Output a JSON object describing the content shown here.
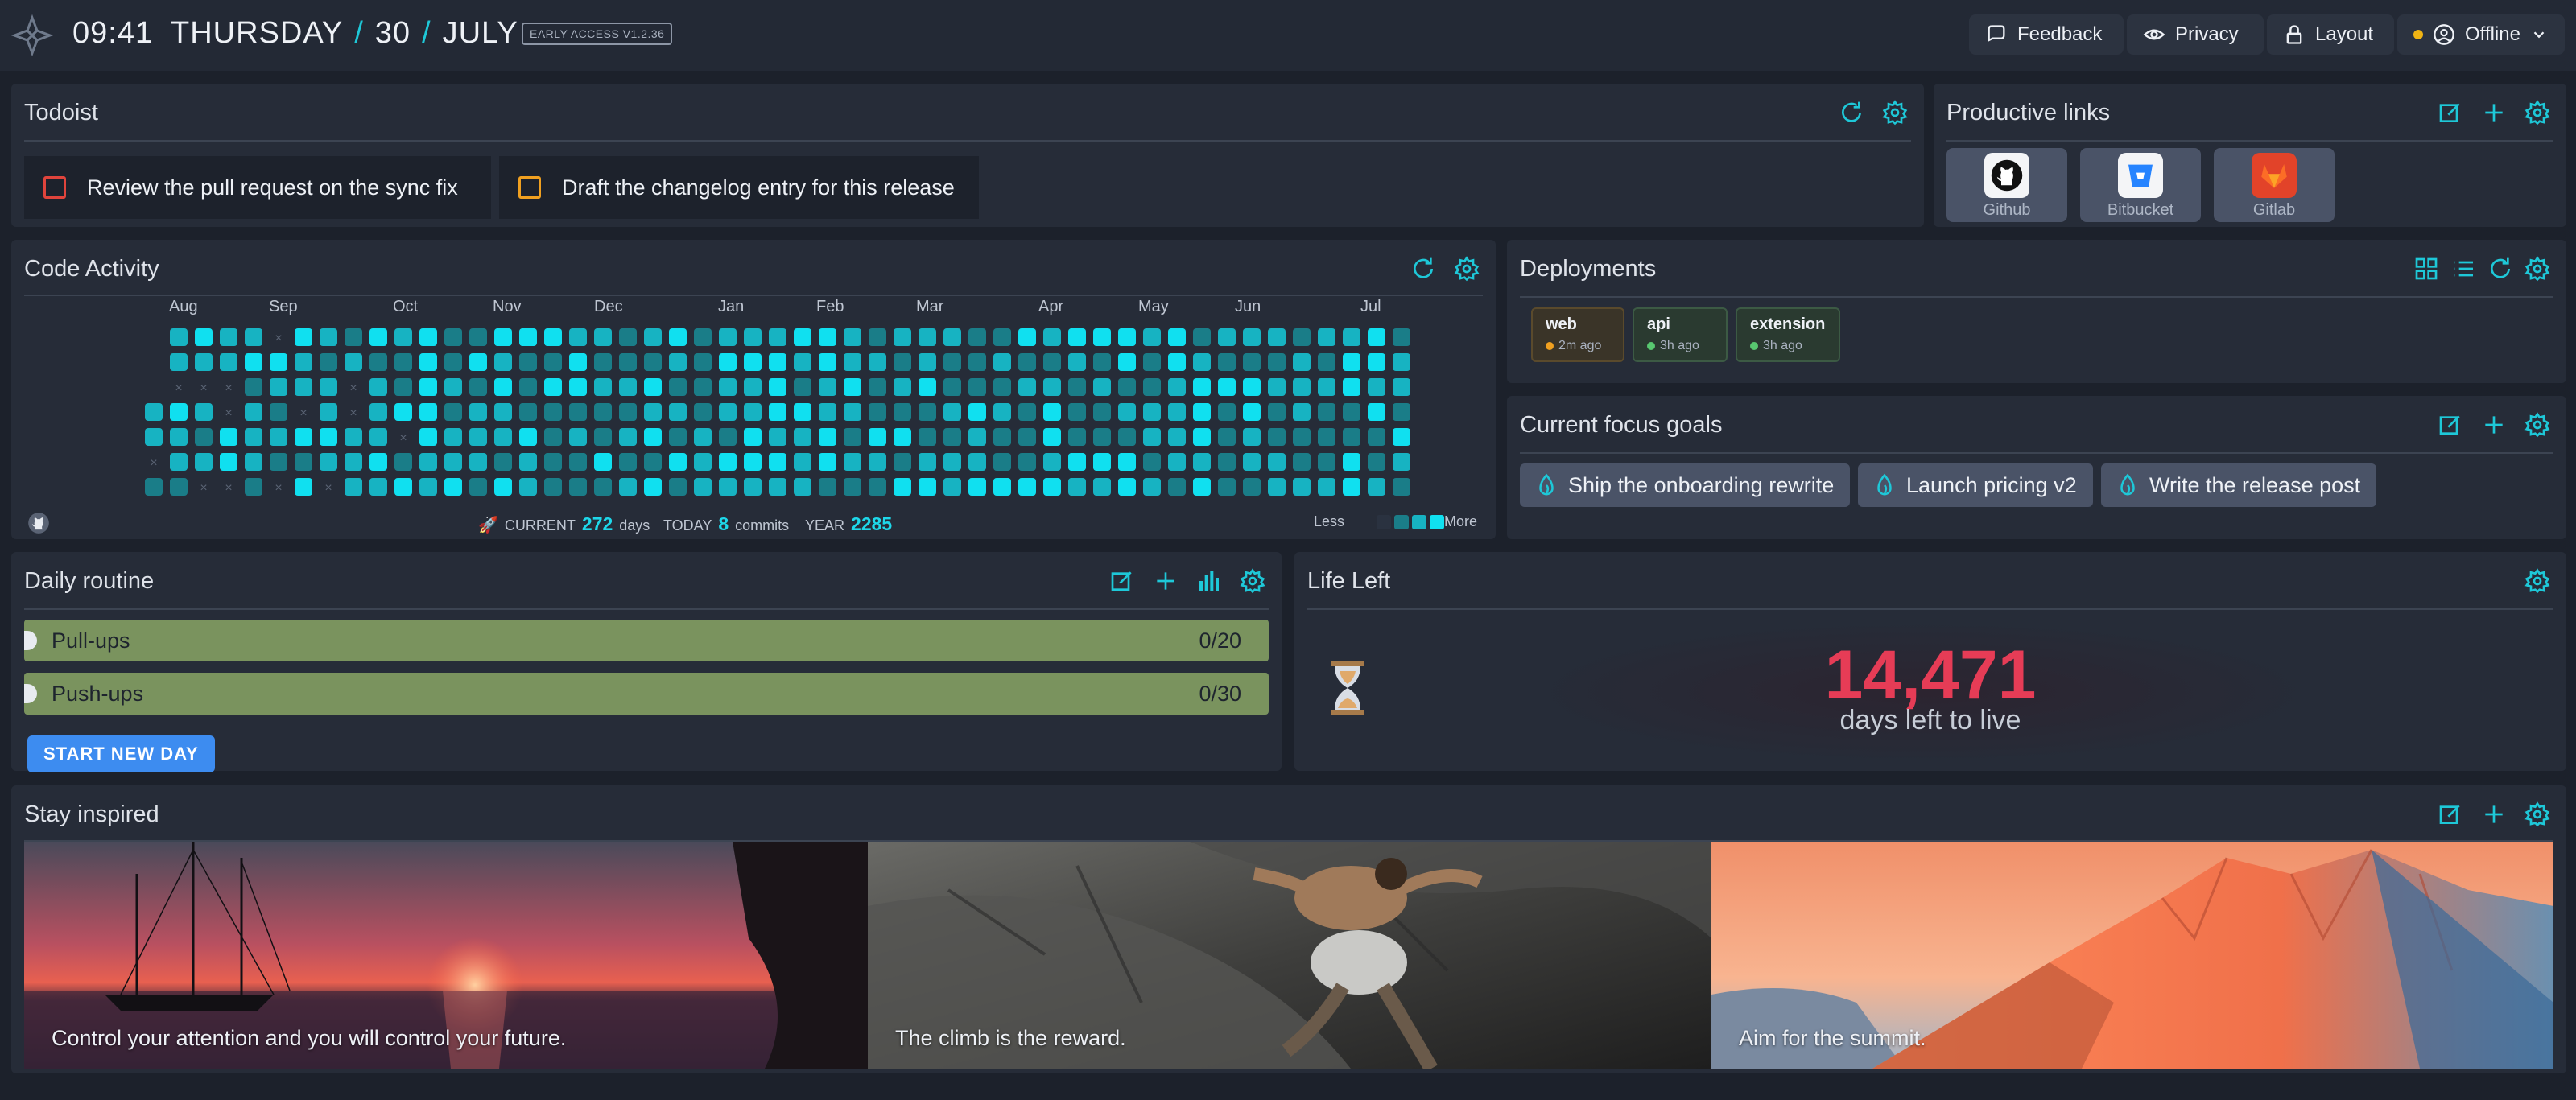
{
  "topbar": {
    "time": "09:41",
    "weekday": "THURSDAY",
    "day": "30",
    "month": "JULY",
    "badge": "EARLY ACCESS V1.2.36",
    "feedback": "Feedback",
    "privacy": "Privacy",
    "layout": "Layout",
    "status": "Offline"
  },
  "todoist": {
    "title": "Todoist",
    "tasks": [
      {
        "label": "Review the pull request on the sync fix",
        "color": "#e0443c"
      },
      {
        "label": "Draft the changelog entry for this release",
        "color": "#f0a020"
      }
    ]
  },
  "links": {
    "title": "Productive links",
    "items": [
      "Github",
      "Bitbucket",
      "Gitlab"
    ]
  },
  "activity": {
    "title": "Code Activity",
    "months": [
      "Aug",
      "Sep",
      "Oct",
      "Nov",
      "Dec",
      "Jan",
      "Feb",
      "Mar",
      "Apr",
      "May",
      "Jun",
      "Jul"
    ],
    "current_label": "CURRENT",
    "current_value": "272",
    "current_unit": "days",
    "today_label": "TODAY",
    "today_value": "8",
    "today_unit": "commits",
    "year_label": "YEAR",
    "year_value": "2285",
    "less": "Less",
    "more": "More"
  },
  "deployments": {
    "title": "Deployments",
    "items": [
      {
        "name": "web",
        "time": "2m ago",
        "dot": "#f0a020"
      },
      {
        "name": "api",
        "time": "3h ago",
        "dot": "#58c870"
      },
      {
        "name": "extension",
        "time": "3h ago",
        "dot": "#58c870"
      }
    ]
  },
  "goals": {
    "title": "Current focus goals",
    "items": [
      "Ship the onboarding rewrite",
      "Launch pricing v2",
      "Write the release post"
    ]
  },
  "routine": {
    "title": "Daily routine",
    "items": [
      {
        "label": "Pull-ups",
        "count": "0/20"
      },
      {
        "label": "Push-ups",
        "count": "0/30"
      }
    ],
    "button": "START NEW DAY"
  },
  "life": {
    "title": "Life Left",
    "number": "14,471",
    "text": "days left to live"
  },
  "inspire": {
    "title": "Stay inspired",
    "quotes": [
      "Control your attention and you will control your future.",
      "The climb is the reward.",
      "Aim for the summit."
    ]
  },
  "colors": {
    "accent": "#1ec8d8",
    "danger": "#e63c56",
    "button": "#3d8cf0"
  }
}
